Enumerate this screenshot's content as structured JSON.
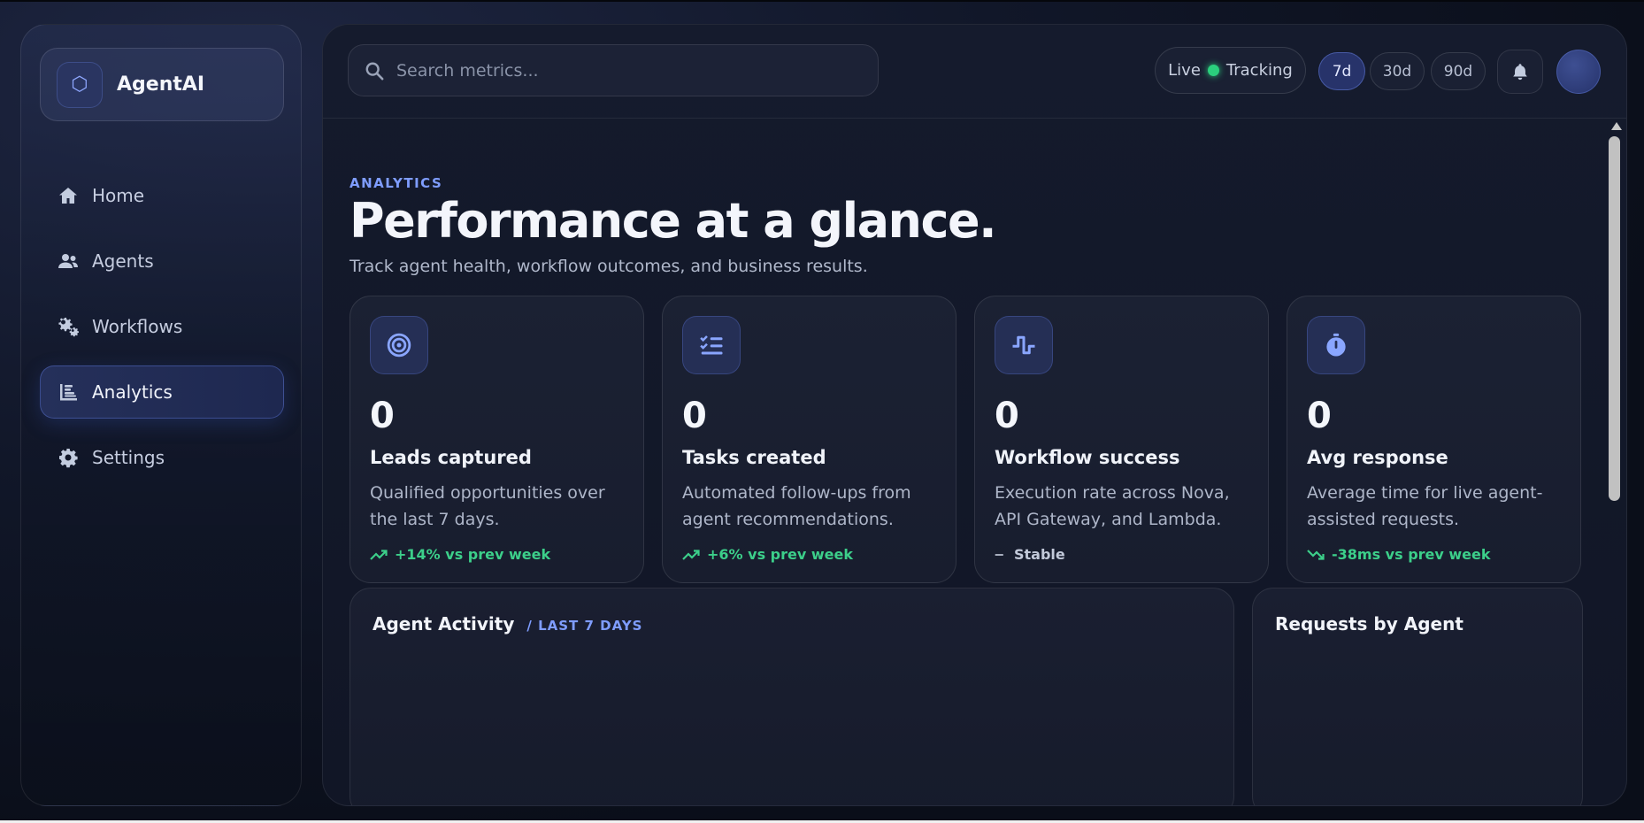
{
  "brand": {
    "name": "AgentAI",
    "icon": "hexagon-icon"
  },
  "sidebar": {
    "items": [
      {
        "label": "Home",
        "icon": "home-icon",
        "active": false
      },
      {
        "label": "Agents",
        "icon": "users-icon",
        "active": false
      },
      {
        "label": "Workflows",
        "icon": "gears-icon",
        "active": false
      },
      {
        "label": "Analytics",
        "icon": "chart-icon",
        "active": true
      },
      {
        "label": "Settings",
        "icon": "gear-icon",
        "active": false
      }
    ]
  },
  "header": {
    "search_placeholder": "Search metrics...",
    "live_label": "Live",
    "tracking_label": "Tracking",
    "ranges": [
      "7d",
      "30d",
      "90d"
    ],
    "active_range": "7d"
  },
  "page": {
    "eyebrow": "ANALYTICS",
    "title": "Performance at a glance.",
    "subtitle": "Track agent health, workflow outcomes, and business results."
  },
  "cards": [
    {
      "icon": "target-icon",
      "value": "0",
      "label": "Leads captured",
      "desc": "Qualified opportunities over the last 7 days.",
      "trend": "+14% vs prev week",
      "trend_type": "up"
    },
    {
      "icon": "checklist-icon",
      "value": "0",
      "label": "Tasks created",
      "desc": "Automated follow-ups from agent recommendations.",
      "trend": "+6% vs prev week",
      "trend_type": "up"
    },
    {
      "icon": "pulse-icon",
      "value": "0",
      "label": "Workflow success",
      "desc": "Execution rate across Nova, API Gateway, and Lambda.",
      "trend": "Stable",
      "trend_type": "flat"
    },
    {
      "icon": "stopwatch-icon",
      "value": "0",
      "label": "Avg response",
      "desc": "Average time for live agent-assisted requests.",
      "trend": "-38ms vs prev week",
      "trend_type": "down"
    }
  ],
  "panels": {
    "activity_title": "Agent Activity",
    "activity_tag": "/ LAST 7 DAYS",
    "requests_title": "Requests by Agent"
  },
  "colors": {
    "accent": "#7f9dff",
    "positive": "#3ccf8a",
    "live": "#2bd07d"
  }
}
